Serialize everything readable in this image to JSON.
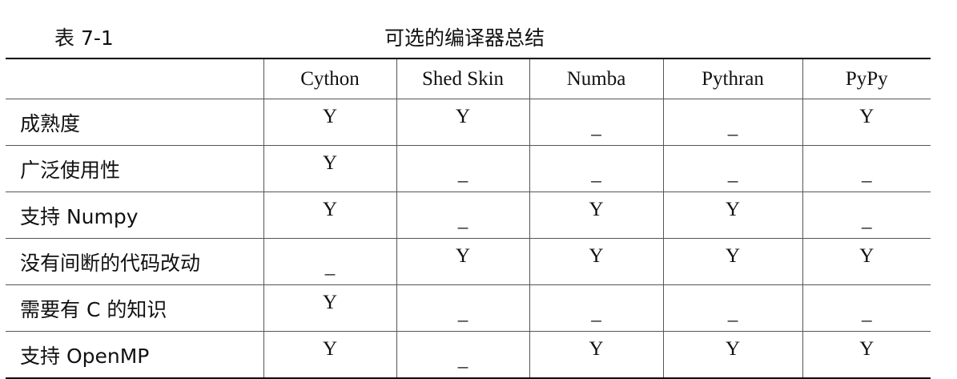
{
  "caption": {
    "number": "表 7-1",
    "title": "可选的编译器总结"
  },
  "table": {
    "columns": [
      "Cython",
      "Shed Skin",
      "Numba",
      "Pythran",
      "PyPy"
    ],
    "rows": [
      {
        "label": "成熟度",
        "values": [
          "Y",
          "Y",
          "_",
          "_",
          "Y"
        ]
      },
      {
        "label": "广泛使用性",
        "values": [
          "Y",
          "_",
          "_",
          "_",
          "_"
        ]
      },
      {
        "label": "支持 Numpy",
        "values": [
          "Y",
          "_",
          "Y",
          "Y",
          "_"
        ]
      },
      {
        "label": "没有间断的代码改动",
        "values": [
          "_",
          "Y",
          "Y",
          "Y",
          "Y"
        ]
      },
      {
        "label": "需要有 C 的知识",
        "values": [
          "Y",
          "_",
          "_",
          "_",
          "_"
        ]
      },
      {
        "label": "支持 OpenMP",
        "values": [
          "Y",
          "_",
          "Y",
          "Y",
          "Y"
        ]
      }
    ]
  }
}
